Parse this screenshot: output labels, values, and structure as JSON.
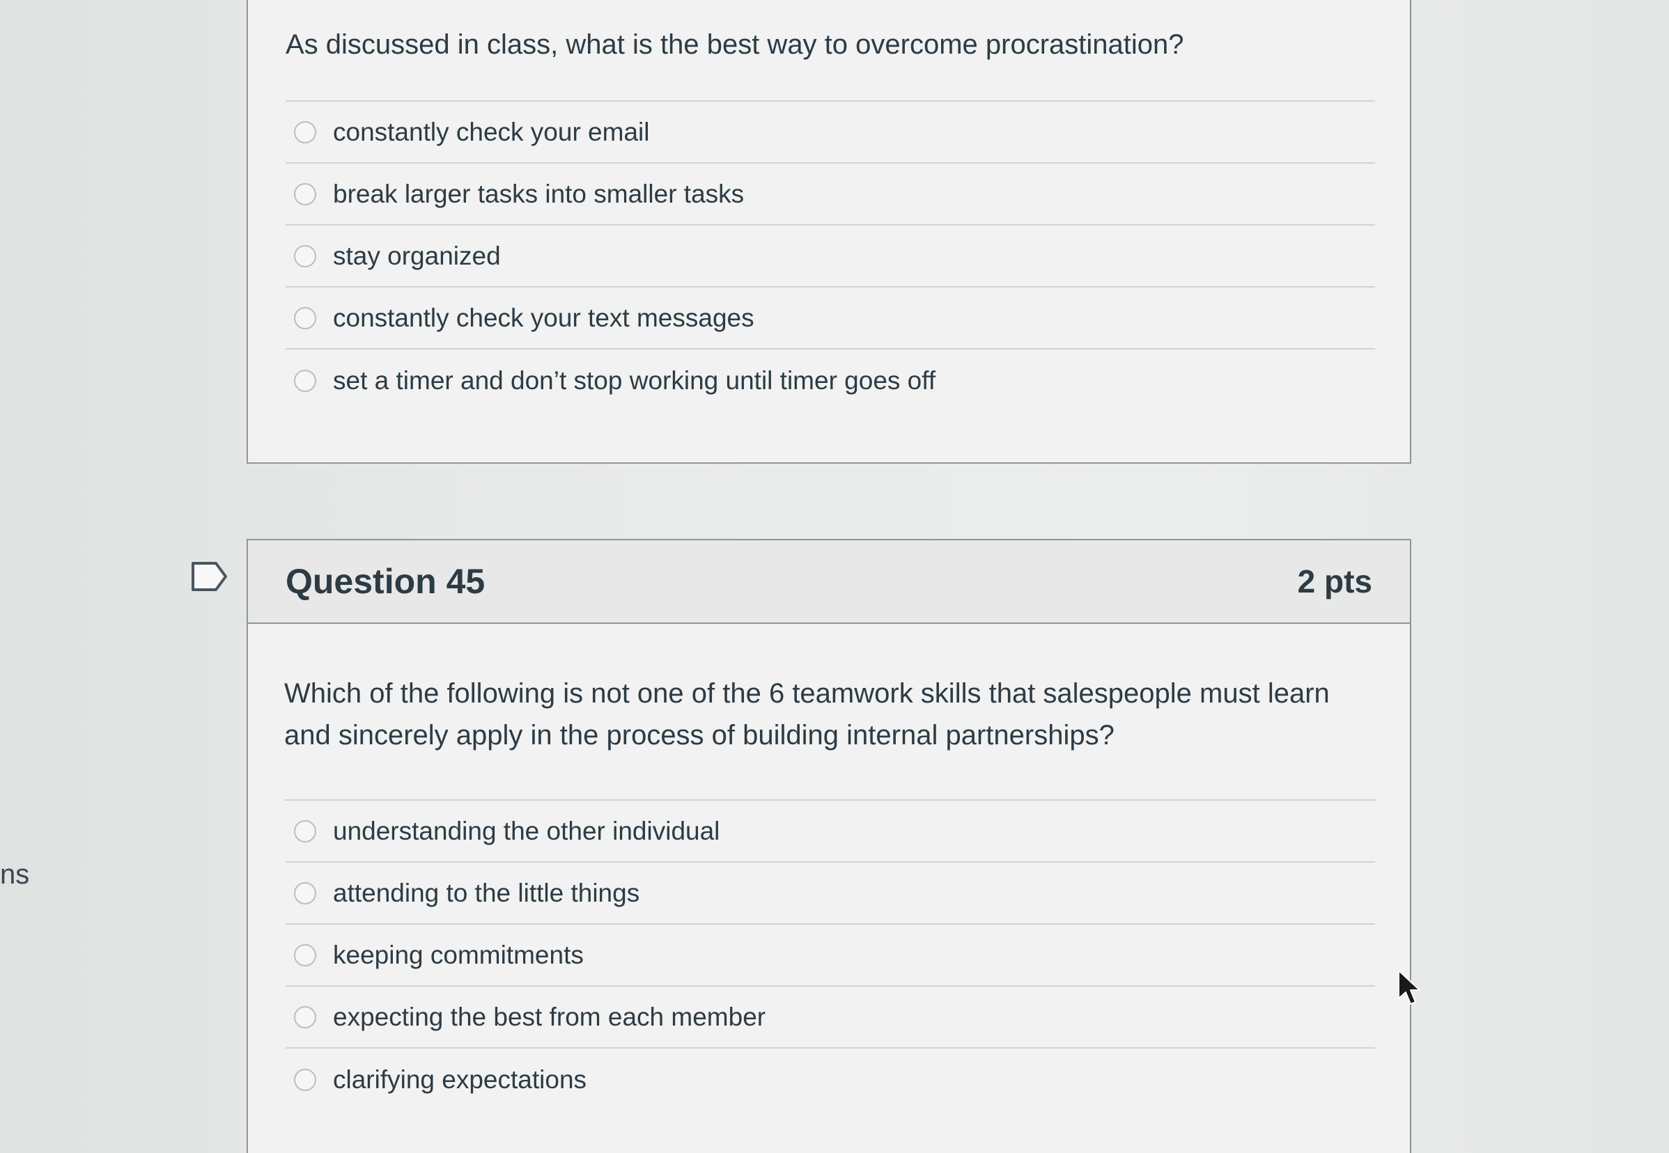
{
  "edge_text": "ns",
  "question_44": {
    "text": "As discussed in class, what is the best way to overcome procrastination?",
    "answers": [
      "constantly check your email",
      "break larger tasks into smaller tasks",
      "stay organized",
      "constantly check your text messages",
      "set a timer and don’t stop working until timer goes off"
    ]
  },
  "question_45": {
    "title": "Question 45",
    "points": "2 pts",
    "text": "Which of the following is not one of the 6  teamwork skills that salespeople must learn and sincerely apply in the process of building internal partnerships?",
    "answers": [
      "understanding the other individual",
      "attending to the little things",
      "keeping commitments",
      "expecting the best from each member",
      "clarifying expectations"
    ]
  },
  "icons": {
    "flag": "flag-question-icon",
    "cursor": "mouse-pointer-icon"
  }
}
